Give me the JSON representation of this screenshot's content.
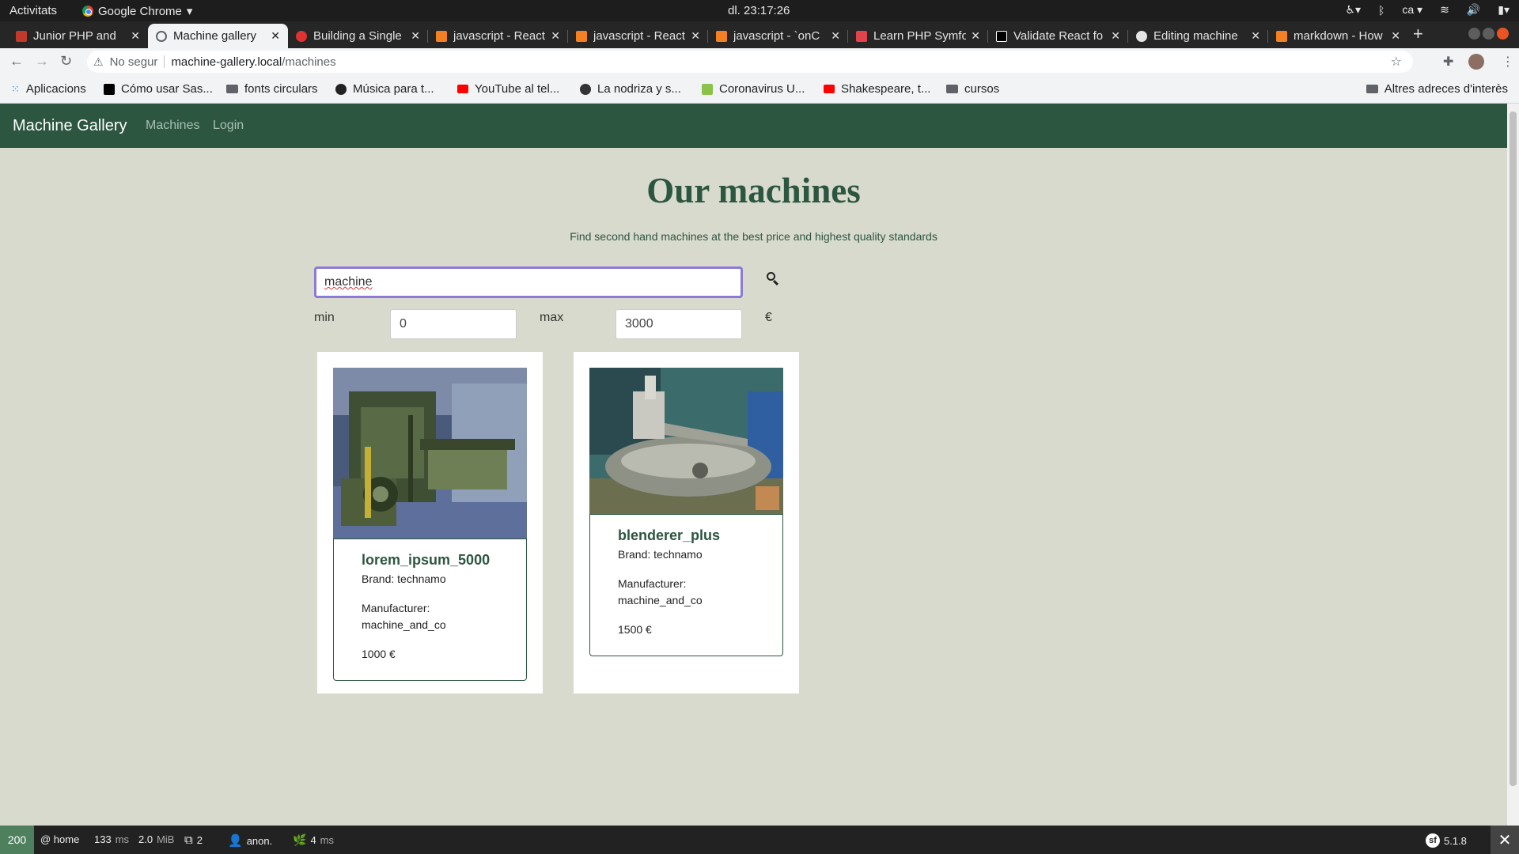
{
  "os": {
    "activities": "Activitats",
    "app_name": "Google Chrome",
    "clock": "dl. 23:17:26",
    "lang": "ca"
  },
  "tabs": [
    {
      "title": "Junior PHP and",
      "favicon_color": "#c0392b"
    },
    {
      "title": "Machine gallery",
      "favicon_color": "#5f6368"
    },
    {
      "title": "Building a Single",
      "favicon_color": "#dd3333"
    },
    {
      "title": "javascript - React",
      "favicon_color": "#f48024"
    },
    {
      "title": "javascript - React",
      "favicon_color": "#f48024"
    },
    {
      "title": "javascript - `onC",
      "favicon_color": "#f48024"
    },
    {
      "title": "Learn PHP Symfo",
      "favicon_color": "#e0434b"
    },
    {
      "title": "Validate React fo",
      "favicon_color": "#000000"
    },
    {
      "title": "Editing machine",
      "favicon_color": "#24292e"
    },
    {
      "title": "markdown - How",
      "favicon_color": "#f48024"
    }
  ],
  "address": {
    "security_label": "No segur",
    "host": "machine-gallery.local",
    "path": "/machines"
  },
  "bookmarks": [
    {
      "label": "Aplicacions",
      "color": "#4285f4"
    },
    {
      "label": "Cómo usar Sas...",
      "color": "#000000"
    },
    {
      "label": "fonts circulars",
      "color": "folder"
    },
    {
      "label": "Música para t...",
      "color": "#222222"
    },
    {
      "label": "YouTube al tel...",
      "color": "#ff0000"
    },
    {
      "label": "La nodriza y s...",
      "color": "#333333"
    },
    {
      "label": "Coronavirus U...",
      "color": "#8bc34a"
    },
    {
      "label": "Shakespeare, t...",
      "color": "#ff0000"
    },
    {
      "label": "cursos",
      "color": "folder"
    }
  ],
  "other_bookmarks": "Altres adreces d'interès",
  "site": {
    "brand": "Machine Gallery",
    "nav": [
      "Machines",
      "Login"
    ],
    "title": "Our machines",
    "subtitle": "Find second hand machines at the best price and highest quality standards",
    "search_value": "machine",
    "min_label": "min",
    "min_value": "0",
    "max_label": "max",
    "max_value": "3000",
    "currency": "€"
  },
  "machines": [
    {
      "name": "lorem_ipsum_5000",
      "brand": "Brand: technamo",
      "manufacturer_label": "Manufacturer:",
      "manufacturer": "machine_and_co",
      "price": "1000 €"
    },
    {
      "name": "blenderer_plus",
      "brand": "Brand: technamo",
      "manufacturer_label": "Manufacturer:",
      "manufacturer": "machine_and_co",
      "price": "1500 €"
    }
  ],
  "symfony": {
    "status": "200",
    "route": "@ home",
    "time_value": "133",
    "time_unit": "ms",
    "memory_value": "2.0",
    "memory_unit": "MiB",
    "forms": "2",
    "user": "anon.",
    "twig_value": "4",
    "twig_unit": "ms",
    "version": "5.1.8"
  }
}
